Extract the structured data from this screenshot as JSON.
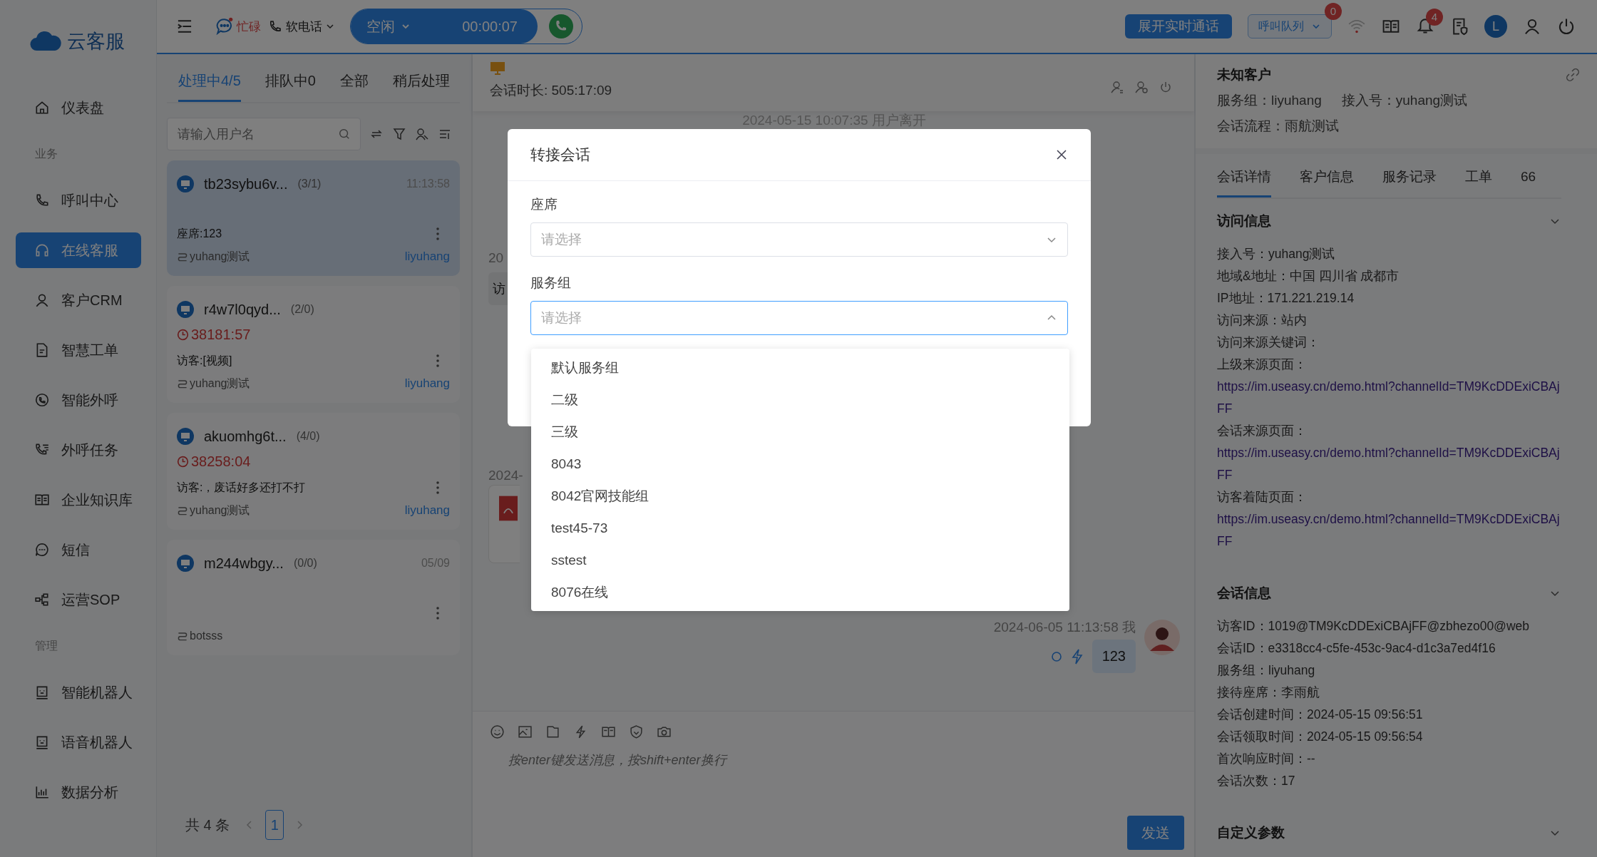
{
  "sidebar": {
    "logo": "云客服",
    "items": [
      {
        "kind": "item",
        "label": "仪表盘",
        "selected": false
      },
      {
        "kind": "group",
        "label": "业务"
      },
      {
        "kind": "item",
        "label": "呼叫中心",
        "selected": false
      },
      {
        "kind": "item",
        "label": "在线客服",
        "selected": true
      },
      {
        "kind": "item",
        "label": "客户CRM",
        "selected": false
      },
      {
        "kind": "item",
        "label": "智慧工单",
        "selected": false
      },
      {
        "kind": "item",
        "label": "智能外呼",
        "selected": false
      },
      {
        "kind": "item",
        "label": "外呼任务",
        "selected": false
      },
      {
        "kind": "item",
        "label": "企业知识库",
        "selected": false
      },
      {
        "kind": "item",
        "label": "短信",
        "selected": false
      },
      {
        "kind": "item",
        "label": "运营SOP",
        "selected": false
      },
      {
        "kind": "group",
        "label": "管理"
      },
      {
        "kind": "item",
        "label": "智能机器人",
        "selected": false
      },
      {
        "kind": "item",
        "label": "语音机器人",
        "selected": false
      },
      {
        "kind": "item",
        "label": "数据分析",
        "selected": false
      }
    ]
  },
  "topbar": {
    "status": "忙碌",
    "phone": "软电话",
    "state": "空闲",
    "timer": "00:00:07",
    "live_call": "展开实时通话",
    "queue": "呼叫队列",
    "queue_badge": "0",
    "notification_badge": "4",
    "avatar": "L"
  },
  "sessions": {
    "tabs": [
      {
        "label": "处理中4/5",
        "selected": true
      },
      {
        "label": "排队中0",
        "selected": false
      },
      {
        "label": "全部",
        "selected": false
      },
      {
        "label": "稍后处理",
        "selected": false
      }
    ],
    "search": {
      "placeholder": "请输入用户名"
    },
    "items": [
      {
        "name": "tb23sybu6v...",
        "count": "(3/1)",
        "time": "11:13:58",
        "preview": "座席:123",
        "route": "yuhang测试",
        "agent": "liyuhang",
        "selected": true
      },
      {
        "name": "r4w7l0qyd...",
        "count": "(2/0)",
        "wait": "38181:57",
        "preview": "访客:[视频]",
        "route": "yuhang测试",
        "agent": "liyuhang",
        "selected": false
      },
      {
        "name": "akuomhg6t...",
        "count": "(4/0)",
        "wait": "38258:04",
        "preview": "访客:，废话好多还打不打",
        "route": "yuhang测试",
        "agent": "liyuhang",
        "selected": false
      },
      {
        "name": "m244wbgy...",
        "count": "(0/0)",
        "time": "05/09",
        "route": "botsss",
        "selected": false
      }
    ],
    "total": "共 4 条",
    "pages": [
      {
        "label": "1",
        "selected": true
      }
    ]
  },
  "chat": {
    "duration": "会话时长: 505:17:09",
    "event": "2024-05-15 10:07:35 用户离开",
    "messages": [
      {
        "kind": "time",
        "text": "20"
      },
      {
        "kind": "bubble",
        "text": "访"
      },
      {
        "kind": "time",
        "text": "2024-"
      },
      {
        "kind": "file"
      },
      {
        "kind": "outgoing",
        "meta": "2024-06-05 11:13:58 我",
        "text": "123"
      }
    ],
    "input": {
      "placeholder": "按enter键发送消息，按shift+enter换行"
    },
    "send": "发送"
  },
  "customer": {
    "name": "未知客户",
    "group": "服务组：liyuhang",
    "access": "接入号：yuhang测试",
    "flow": "会话流程：雨航测试",
    "tabs": [
      {
        "label": "会话详情",
        "selected": true
      },
      {
        "label": "客户信息",
        "selected": false
      },
      {
        "label": "服务记录",
        "selected": false
      },
      {
        "label": "工单",
        "selected": false
      },
      {
        "label": "66",
        "selected": false
      }
    ],
    "sections": [
      {
        "title": "访问信息",
        "expanded": true,
        "rows": [
          {
            "text": "接入号：yuhang测试"
          },
          {
            "text": "地域&地址：中国 四川省 成都市"
          },
          {
            "text": "IP地址：171.221.219.14"
          },
          {
            "text": "访问来源：站内"
          },
          {
            "text": "访问来源关键词："
          },
          {
            "label": "上级来源页面：",
            "link": "https://im.useasy.cn/demo.html?channelId=TM9KcDDExiCBAjFF"
          },
          {
            "label": "会话来源页面：",
            "link": "https://im.useasy.cn/demo.html?channelId=TM9KcDDExiCBAjFF"
          },
          {
            "label": "访客着陆页面：",
            "link": "https://im.useasy.cn/demo.html?channelId=TM9KcDDExiCBAjFF"
          }
        ]
      },
      {
        "title": "会话信息",
        "expanded": true,
        "rows": [
          {
            "text": "访客ID：1019@TM9KcDDExiCBAjFF@zbhezo00@web"
          },
          {
            "text": "会话ID：e3318cc4-c5fe-453c-9ac4-d1c3a7ed4f16"
          },
          {
            "text": "服务组：liyuhang"
          },
          {
            "text": "接待座席：李雨航"
          },
          {
            "text": "会话创建时间：2024-05-15 09:56:51"
          },
          {
            "text": "会话领取时间：2024-05-15 09:56:54"
          },
          {
            "text": "首次响应时间：--"
          },
          {
            "text": "会话次数：17"
          }
        ]
      },
      {
        "title": "自定义参数",
        "expanded": true
      }
    ]
  },
  "dialog": {
    "title": "转接会话",
    "fields": [
      {
        "label": "座席",
        "placeholder": "请选择",
        "open": false
      },
      {
        "label": "服务组",
        "placeholder": "请选择",
        "open": true
      }
    ],
    "options": [
      "默认服务组",
      "二级",
      "三级",
      "8043",
      "8042官网技能组",
      "test45-73",
      "sstest",
      "8076在线"
    ]
  }
}
